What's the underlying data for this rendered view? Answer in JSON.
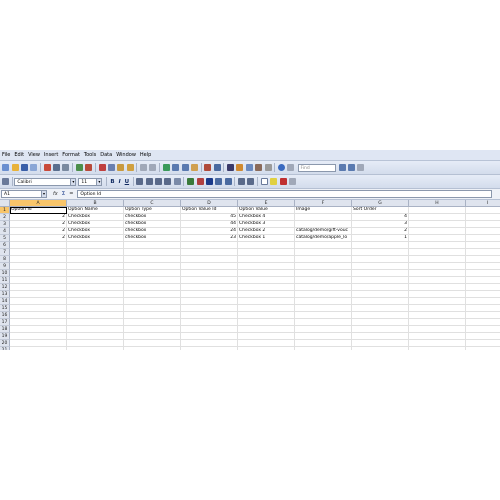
{
  "menu": [
    "File",
    "Edit",
    "View",
    "Insert",
    "Format",
    "Tools",
    "Data",
    "Window",
    "Help"
  ],
  "toolbar": {
    "find_placeholder": "Find",
    "font_name": "Calibri",
    "font_size": "11",
    "bold": "B",
    "italic": "I",
    "underline": "U"
  },
  "formula": {
    "cell_ref": "A1",
    "fx": "fx",
    "sigma": "Σ",
    "equals": "=",
    "content": "Option Id"
  },
  "grid": {
    "columns": [
      "A",
      "B",
      "C",
      "D",
      "E",
      "F",
      "G",
      "H",
      "I"
    ],
    "row_numbers": [
      "1",
      "2",
      "3",
      "4",
      "5",
      "6",
      "7",
      "8",
      "9",
      "10",
      "11",
      "12",
      "13",
      "14",
      "15",
      "16",
      "17",
      "18",
      "19",
      "20",
      "21"
    ],
    "rows": [
      [
        "Option Id",
        "Option Name",
        "Option Type",
        "Option Value Id",
        "Option Value",
        "Image",
        "Sort Order",
        "",
        ""
      ],
      [
        "2",
        "Checkbox",
        "checkbox",
        "45",
        "Checkbox 4",
        "",
        "4",
        "",
        ""
      ],
      [
        "2",
        "Checkbox",
        "checkbox",
        "44",
        "Checkbox 3",
        "",
        "3",
        "",
        ""
      ],
      [
        "2",
        "Checkbox",
        "checkbox",
        "24",
        "Checkbox 2",
        "catalog/demo/gift-vouc",
        "2",
        "",
        ""
      ],
      [
        "2",
        "Checkbox",
        "checkbox",
        "23",
        "Checkbox 1",
        "catalog/demo/apple_lo",
        "1",
        "",
        ""
      ]
    ]
  },
  "colors": {
    "selected_header": "#f8c56a",
    "toolbar_bg": "#d3dcec"
  }
}
